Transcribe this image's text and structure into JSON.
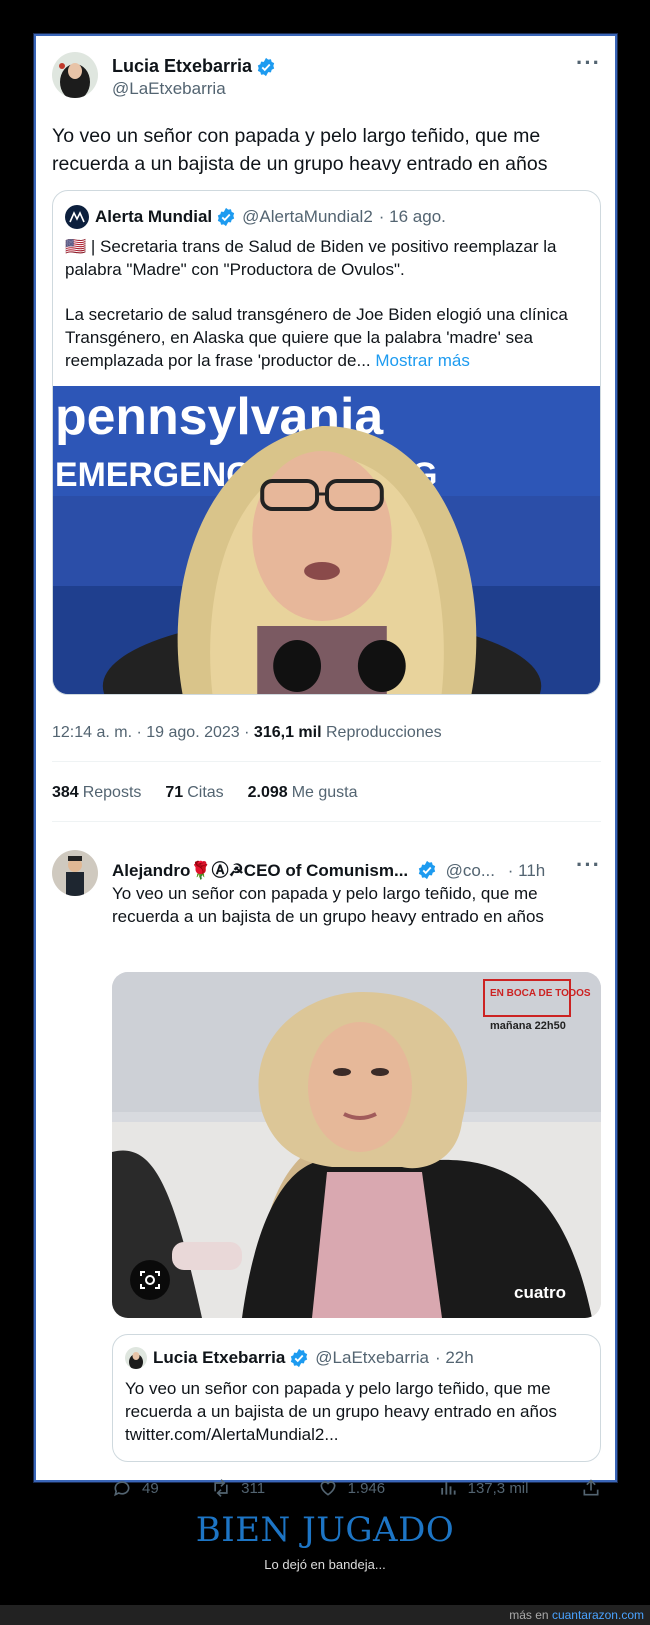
{
  "main_tweet": {
    "author_name": "Lucia Etxebarria",
    "author_handle": "@LaEtxebarria",
    "text": "Yo veo un señor con papada y pelo largo teñido, que me recuerda a un bajista de un grupo heavy entrado en años",
    "quote": {
      "author_name": "Alerta Mundial",
      "author_handle": "@AlertaMundial2",
      "date": "· 16 ago.",
      "line1": "🇺🇸 | Secretaria trans de Salud de Biden ve positivo reemplazar la palabra \"Madre\" con \"Productora de Ovulos\".",
      "line2": "La secretario de salud transgénero de Joe Biden elogió una clínica Transgénero, en Alaska que quiere que la palabra 'madre' sea reemplazada por la frase 'productor de...",
      "more_link": "Mostrar más",
      "image_text_top": "pennsylvania",
      "image_text_mid": "EMERGENC          EMENT AG"
    },
    "time": "12:14 a. m. · 19 ago. 2023 ·",
    "views_count": "316,1 mil",
    "views_label": "Reproducciones",
    "reposts_count": "384",
    "reposts_label": "Reposts",
    "quotes_count": "71",
    "quotes_label": "Citas",
    "likes_count": "2.098",
    "likes_label": "Me gusta"
  },
  "reply": {
    "author_name": "Alejandro🌹Ⓐ☭CEO of Comunism...",
    "author_handle": "@co...",
    "time": "· 11h",
    "text": "Yo veo un señor con papada y pelo largo teñido, que me recuerda a un bajista de un grupo heavy entrado en años",
    "image_badge": "EN BOCA DE TODOS",
    "image_badge_time": "mañana 22h50",
    "image_watermark": "cuatro",
    "quote": {
      "author_name": "Lucia Etxebarria",
      "author_handle": "@LaEtxebarria",
      "time": "· 22h",
      "text": "Yo veo un señor con papada y pelo largo teñido, que me recuerda a un bajista de un grupo heavy entrado en años",
      "link": "twitter.com/AlertaMundial2..."
    },
    "actions": {
      "replies": "49",
      "reposts": "311",
      "likes": "1.946",
      "views": "137,3 mil"
    }
  },
  "caption": {
    "title": "BIEN JUGADO",
    "subtitle": "Lo dejó en bandeja..."
  },
  "footer": {
    "prefix": "más en",
    "site": "cuantarazon.com"
  },
  "colors": {
    "accent": "#1d9bf0",
    "frame_border": "#3a66b8",
    "caption_blue": "#1d75c5"
  }
}
